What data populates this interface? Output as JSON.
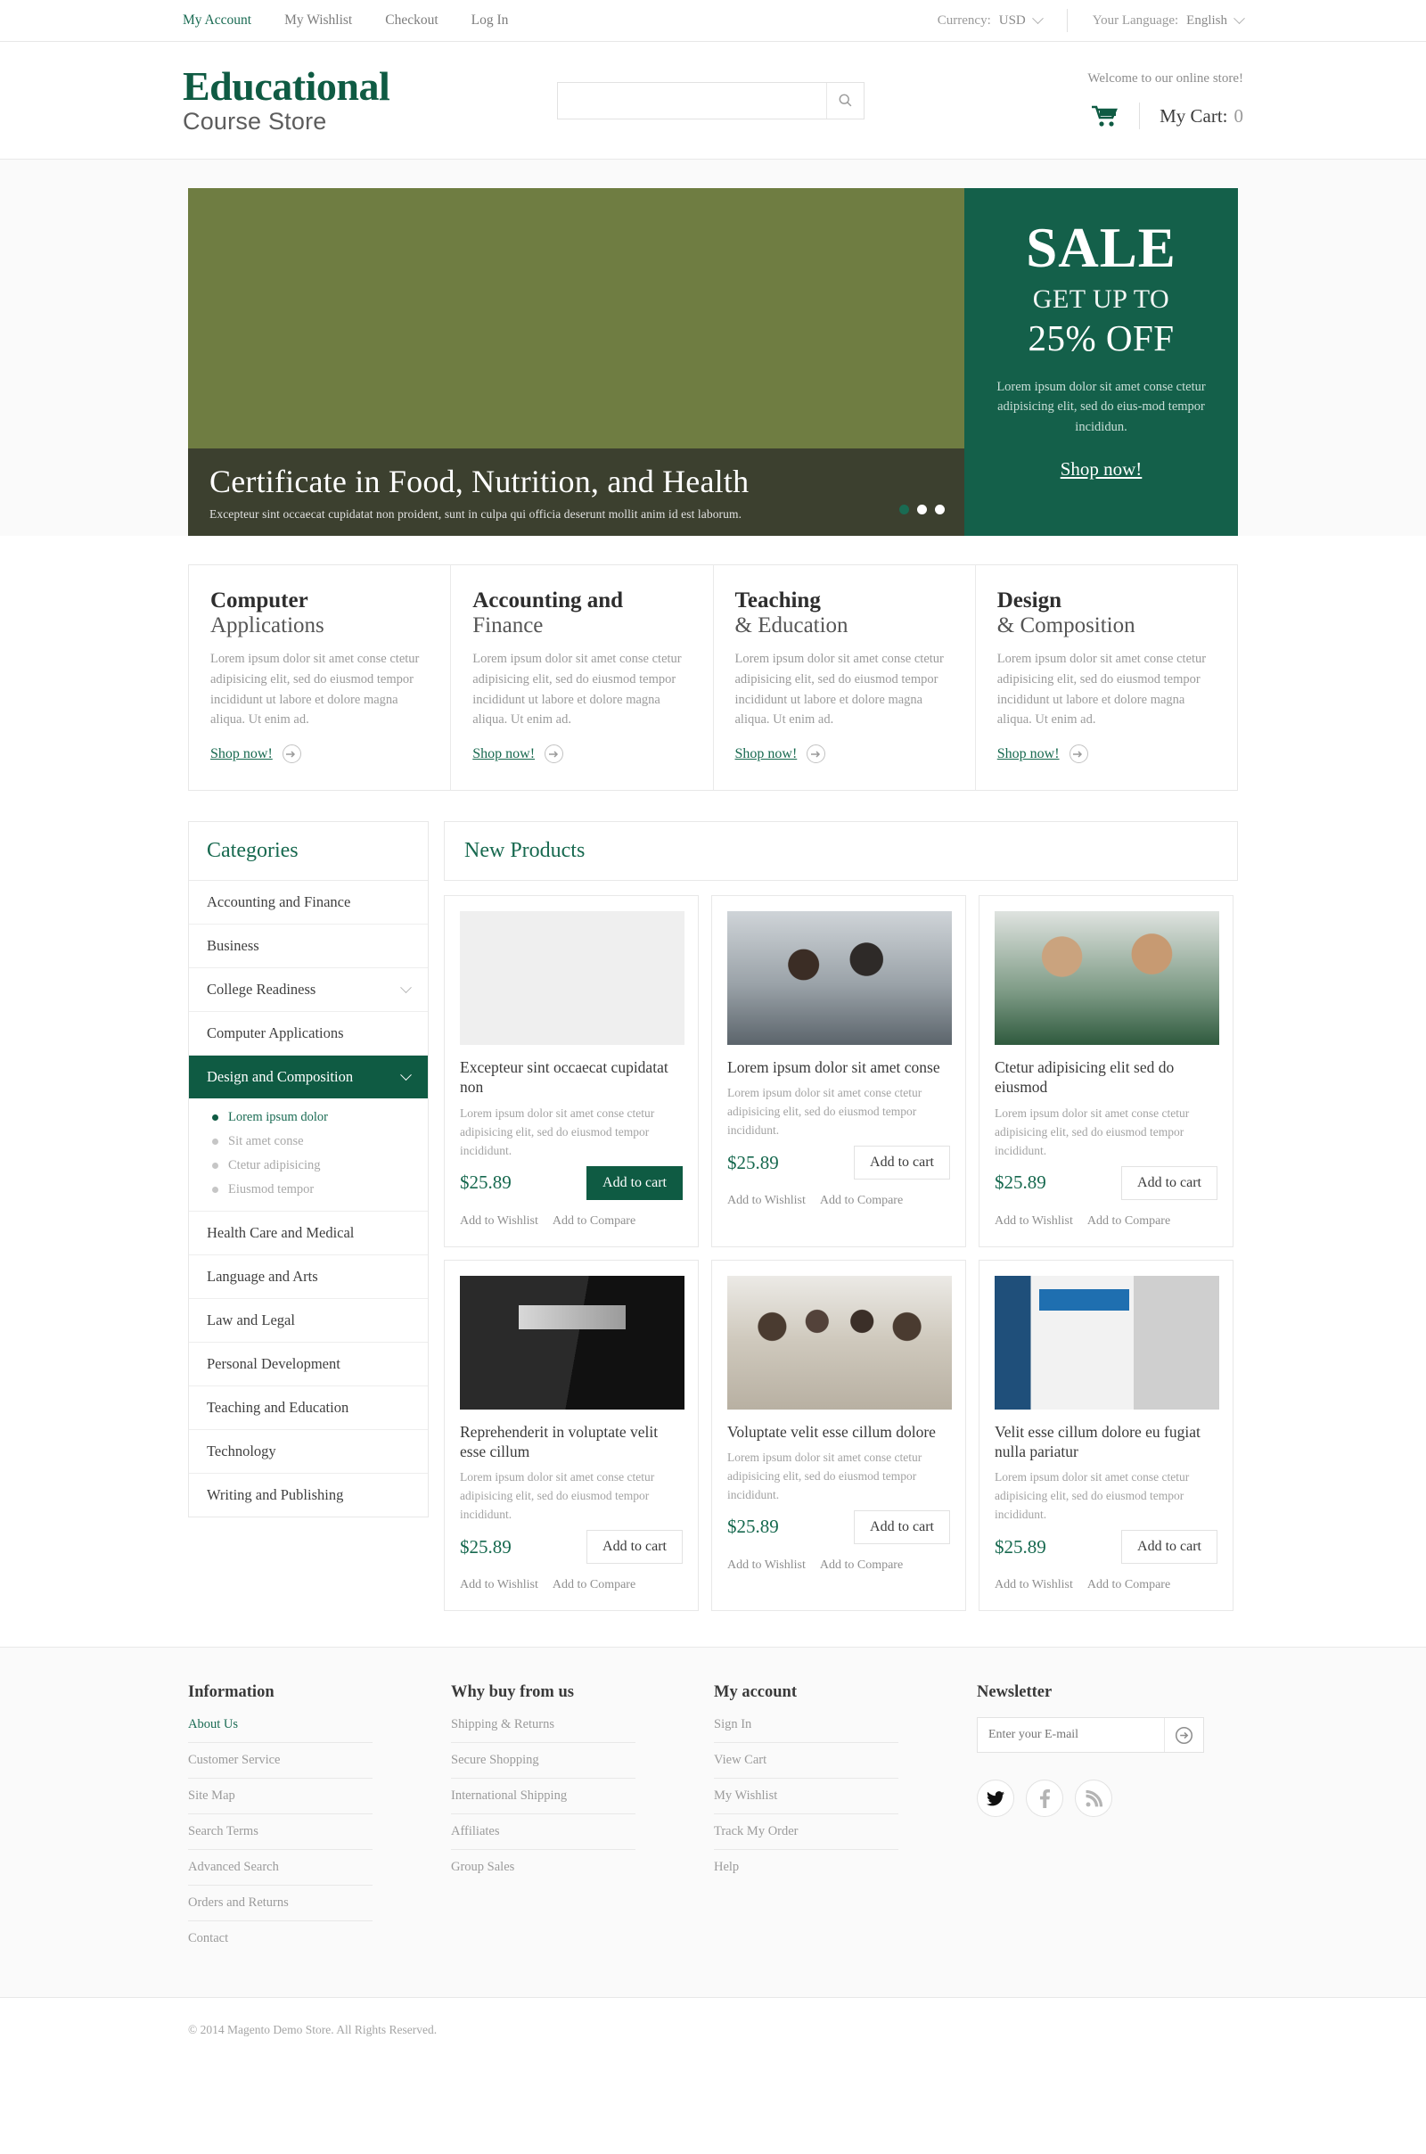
{
  "topbar": {
    "links": [
      {
        "label": "My Account",
        "active": true
      },
      {
        "label": "My Wishlist",
        "active": false
      },
      {
        "label": "Checkout",
        "active": false
      },
      {
        "label": "Log In",
        "active": false
      }
    ],
    "currency_label": "Currency:",
    "currency_value": "USD",
    "language_label": "Your Language:",
    "language_value": "English"
  },
  "header": {
    "logo_main": "Educational",
    "logo_sub": "Course Store",
    "search_value": "",
    "search_placeholder": "",
    "search_icon": "search-icon",
    "welcome": "Welcome to our online store!",
    "cart_icon": "shopping-cart-icon",
    "cart_label": "My Cart:",
    "cart_count": "0"
  },
  "slider": {
    "title": "Certificate in Food,  Nutrition, and Health",
    "subtitle": "Excepteur sint occaecat cupidatat non proident, sunt in culpa qui officia deserunt mollit anim id est laborum.",
    "dots": [
      true,
      false,
      false
    ],
    "sale": {
      "big": "SALE",
      "get": "GET UP TO",
      "percent": "25% OFF",
      "text": "Lorem ipsum dolor sit amet conse ctetur adipisicing elit, sed do eius-mod tempor incididun.",
      "cta": "Shop now!",
      "bg_color": "#14604a"
    }
  },
  "features": [
    {
      "title": "Computer",
      "subtitle": "Applications",
      "text": "Lorem ipsum dolor sit amet conse ctetur adipisicing elit, sed do eiusmod tempor incididunt ut labore et dolore magna aliqua. Ut enim ad.",
      "cta": "Shop now!"
    },
    {
      "title": "Accounting and",
      "subtitle": "Finance",
      "text": "Lorem ipsum dolor sit amet conse ctetur adipisicing elit, sed do eiusmod tempor incididunt ut labore et dolore magna aliqua. Ut enim ad.",
      "cta": "Shop now!"
    },
    {
      "title": "Teaching",
      "subtitle": "& Education",
      "text": "Lorem ipsum dolor sit amet conse ctetur adipisicing elit, sed do eiusmod tempor incididunt ut labore et dolore magna aliqua. Ut enim ad.",
      "cta": "Shop now!"
    },
    {
      "title": "Design",
      "subtitle": "& Composition",
      "text": "Lorem ipsum dolor sit amet conse ctetur adipisicing elit, sed do eiusmod tempor incididunt ut labore et dolore magna aliqua. Ut enim ad.",
      "cta": "Shop now!"
    }
  ],
  "sidebar": {
    "heading": "Categories",
    "items": [
      {
        "label": "Accounting and Finance",
        "caret": false,
        "active": false
      },
      {
        "label": "Business",
        "caret": false,
        "active": false
      },
      {
        "label": "College Readiness",
        "caret": true,
        "active": false
      },
      {
        "label": "Computer Applications",
        "caret": false,
        "active": false
      },
      {
        "label": "Design and Composition",
        "caret": true,
        "active": true
      },
      {
        "label": "Health Care and Medical",
        "caret": false,
        "active": false
      },
      {
        "label": "Language and Arts",
        "caret": false,
        "active": false
      },
      {
        "label": "Law and Legal",
        "caret": false,
        "active": false
      },
      {
        "label": "Personal Development",
        "caret": false,
        "active": false
      },
      {
        "label": "Teaching and Education",
        "caret": false,
        "active": false
      },
      {
        "label": "Technology",
        "caret": false,
        "active": false
      },
      {
        "label": "Writing and Publishing",
        "caret": false,
        "active": false
      }
    ],
    "subitems": [
      {
        "label": "Lorem ipsum dolor",
        "active": true
      },
      {
        "label": "Sit amet conse",
        "active": false
      },
      {
        "label": "Ctetur adipisicing",
        "active": false
      },
      {
        "label": "Eiusmod tempor",
        "active": false
      }
    ]
  },
  "products": {
    "heading": "New Products",
    "wishlist_label": "Add to Wishlist",
    "compare_label": "Add to Compare",
    "items": [
      {
        "title": "Excepteur sint occaecat cupidatat non",
        "desc": "Lorem ipsum dolor sit amet conse ctetur adipisicing elit, sed do eiusmod tempor incididunt.",
        "price": "$25.89",
        "button": "Add to cart",
        "highlighted": true,
        "art": "art-cake"
      },
      {
        "title": "Lorem ipsum dolor sit amet conse",
        "desc": "Lorem ipsum dolor sit amet conse ctetur adipisicing elit, sed do eiusmod tempor incididunt.",
        "price": "$25.89",
        "button": "Add to cart",
        "highlighted": false,
        "art": "art-office"
      },
      {
        "title": "Ctetur adipisicing elit sed do eiusmod",
        "desc": "Lorem ipsum dolor sit amet conse ctetur adipisicing elit, sed do eiusmod tempor incididunt.",
        "price": "$25.89",
        "button": "Add to cart",
        "highlighted": false,
        "art": "art-lab"
      },
      {
        "title": "Reprehenderit in voluptate velit esse cillum",
        "desc": "Lorem ipsum dolor sit amet conse ctetur adipisicing elit, sed do eiusmod tempor incididunt.",
        "price": "$25.89",
        "button": "Add to cart",
        "highlighted": false,
        "art": "art-nero"
      },
      {
        "title": "Voluptate velit esse cillum dolore",
        "desc": "Lorem ipsum dolor sit amet conse ctetur adipisicing elit, sed do eiusmod tempor incididunt.",
        "price": "$25.89",
        "button": "Add to cart",
        "highlighted": false,
        "art": "art-team"
      },
      {
        "title": "Velit esse cillum dolore eu fugiat nulla pariatur",
        "desc": "Lorem ipsum dolor sit amet conse ctetur adipisicing elit, sed do eiusmod tempor incididunt.",
        "price": "$25.89",
        "button": "Add to cart",
        "highlighted": false,
        "art": "art-eset"
      }
    ]
  },
  "footer": {
    "columns": [
      {
        "heading": "Information",
        "links": [
          {
            "label": "About Us",
            "active": true
          },
          {
            "label": "Customer Service",
            "active": false
          },
          {
            "label": "Site Map",
            "active": false
          },
          {
            "label": "Search Terms",
            "active": false
          },
          {
            "label": "Advanced Search",
            "active": false
          },
          {
            "label": "Orders and Returns",
            "active": false
          },
          {
            "label": "Contact",
            "active": false
          }
        ]
      },
      {
        "heading": "Why buy from us",
        "links": [
          {
            "label": "Shipping & Returns",
            "active": false
          },
          {
            "label": "Secure Shopping",
            "active": false
          },
          {
            "label": "International Shipping",
            "active": false
          },
          {
            "label": "Affiliates",
            "active": false
          },
          {
            "label": "Group Sales",
            "active": false
          }
        ]
      },
      {
        "heading": "My account",
        "links": [
          {
            "label": "Sign In",
            "active": false
          },
          {
            "label": "View Cart",
            "active": false
          },
          {
            "label": "My Wishlist",
            "active": false
          },
          {
            "label": "Track My Order",
            "active": false
          },
          {
            "label": "Help",
            "active": false
          }
        ]
      }
    ],
    "newsletter": {
      "heading": "Newsletter",
      "value": "",
      "placeholder": "Enter your E-mail",
      "submit_icon": "arrow-right-circle-icon"
    },
    "socials": [
      {
        "name": "twitter-icon",
        "active": true
      },
      {
        "name": "facebook-icon",
        "active": false
      },
      {
        "name": "rss-icon",
        "active": false
      }
    ],
    "copyright": "© 2014 Magento Demo Store. All Rights Reserved."
  }
}
